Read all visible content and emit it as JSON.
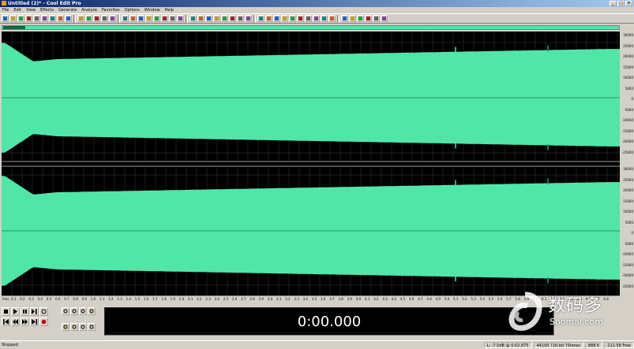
{
  "window": {
    "title": "Untitled (2)* - Cool Edit Pro",
    "controls": [
      "_",
      "□",
      "×"
    ]
  },
  "menu": [
    "File",
    "Edit",
    "View",
    "Effects",
    "Generate",
    "Analyze",
    "Favorites",
    "Options",
    "Window",
    "Help"
  ],
  "waveform": {
    "background": "#000000",
    "fill": "#50e6a8",
    "grid": "#3a3a3a",
    "selection_line": "#c00000"
  },
  "amplitude_ruler": {
    "top_channel": [
      "30000",
      "25000",
      "20000",
      "15000",
      "10000",
      "5000",
      "0",
      "-5000",
      "-10000",
      "-15000",
      "-20000",
      "-25000"
    ],
    "bottom_channel": [
      "30000",
      "25000",
      "20000",
      "15000",
      "10000",
      "5000",
      "0",
      "-5000",
      "-10000",
      "-15000",
      "-20000",
      "-25000"
    ],
    "unit": "smpl"
  },
  "time_ruler": {
    "start_label": "hms",
    "labels": [
      "0.1",
      "0.2",
      "0.3",
      "0.4",
      "0.5",
      "0.6",
      "0.7",
      "0.8",
      "0.9",
      "1.0",
      "1.1",
      "1.2",
      "1.3",
      "1.4",
      "1.5",
      "1.6",
      "1.7",
      "1.8",
      "1.9",
      "2.0",
      "2.1",
      "2.2",
      "2.3",
      "2.4",
      "2.5",
      "2.6",
      "2.7",
      "2.8",
      "2.9",
      "3.0",
      "3.1",
      "3.2",
      "3.3",
      "3.4",
      "3.5",
      "3.6",
      "3.7",
      "3.8",
      "3.9",
      "4.0",
      "4.1",
      "4.2",
      "4.3",
      "4.4",
      "4.5",
      "4.6",
      "4.7",
      "4.8",
      "4.9",
      "5.0",
      "5.1",
      "5.2",
      "5.3",
      "5.4",
      "5.5",
      "5.6",
      "5.7",
      "5.8",
      "5.9",
      "6.0",
      "6.1",
      "6.2",
      "6.3",
      "6.4",
      "6.5",
      "6.6",
      "6.7",
      "6.8"
    ]
  },
  "time_display": "0:00.000",
  "status": {
    "left": "Stopped",
    "cursor": "L: -7.5dB @ 0:02.875",
    "format": "44100 ?16-bit ?Stereo",
    "size": "888 K",
    "free": "212.58 Free"
  },
  "watermark": {
    "cn": "数码多",
    "en": "Soomal.com"
  }
}
